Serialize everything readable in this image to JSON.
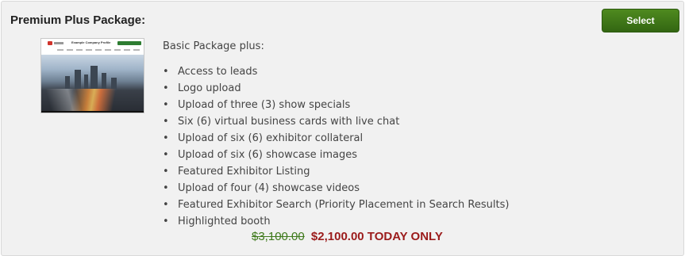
{
  "package": {
    "title": "Premium Plus Package:",
    "select_label": "Select",
    "thumbnail": {
      "headline": "Example Company Profile"
    },
    "intro": "Basic Package plus:",
    "features": [
      "Access to leads",
      "Logo upload",
      "Upload of three (3) show specials",
      "Six (6) virtual business cards with live chat",
      "Upload of six (6) exhibitor collateral",
      "Upload of six (6) showcase images",
      "Featured Exhibitor Listing",
      "Upload of four (4) showcase videos",
      "Featured Exhibitor Search (Priority Placement in Search Results)",
      "Highlighted booth"
    ],
    "bullet": "•",
    "old_price": "$3,100.00",
    "new_price": "$2,100.00 TODAY ONLY"
  },
  "colors": {
    "panel_bg": "#f1f1f1",
    "button_green": "#3f7a1c",
    "old_price": "#3f7a1c",
    "new_price": "#9b1b1b"
  }
}
